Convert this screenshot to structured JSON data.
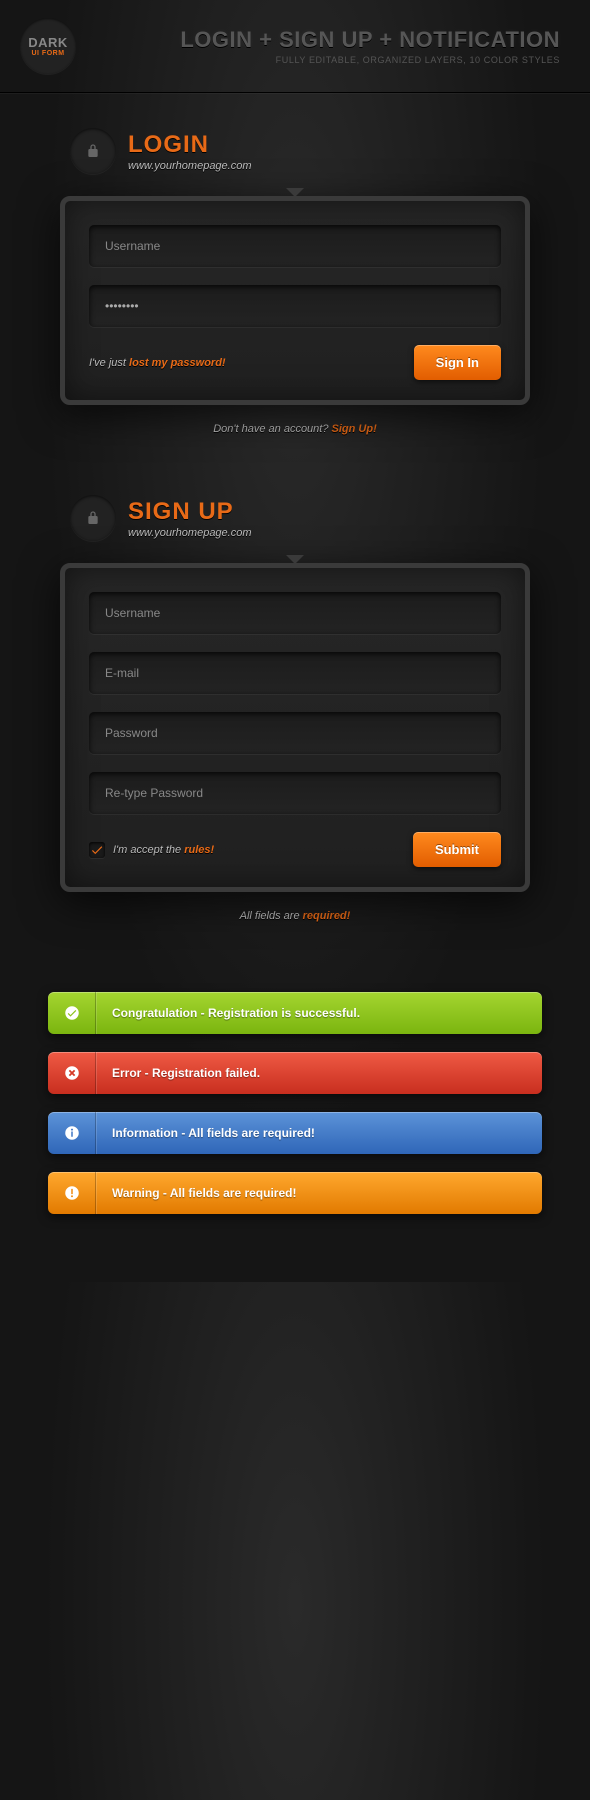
{
  "header": {
    "logo_line1": "DARK",
    "logo_line2": "UI FORM",
    "title": "LOGIN + SIGN UP + NOTIFICATION",
    "subtitle": "FULLY EDITABLE, ORGANIZED LAYERS, 10 COLOR STYLES"
  },
  "login": {
    "title": "LOGIN",
    "subtitle": "www.yourhomepage.com",
    "username_placeholder": "Username",
    "password_value": "••••••••",
    "lost_prefix": "I've just ",
    "lost_link": "lost my password!",
    "button": "Sign In",
    "under_prefix": "Don't have an account? ",
    "under_link": "Sign Up!"
  },
  "signup": {
    "title": "SIGN UP",
    "subtitle": "www.yourhomepage.com",
    "username_placeholder": "Username",
    "email_placeholder": "E-mail",
    "password_placeholder": "Password",
    "repass_placeholder": "Re-type Password",
    "accept_prefix": "I'm accept the ",
    "accept_link": "rules!",
    "button": "Submit",
    "under_prefix": "All fields are ",
    "under_link": "required!"
  },
  "notifications": {
    "success": "Congratulation - Registration is successful.",
    "error": "Error - Registration failed.",
    "info": "Information - All fields are required!",
    "warning": "Warning - All fields are required!"
  },
  "colors": {
    "accent": "#e86a17",
    "success": "#8bc21a",
    "error": "#d63a27",
    "info": "#3f76c6",
    "warning": "#ef8c12"
  }
}
